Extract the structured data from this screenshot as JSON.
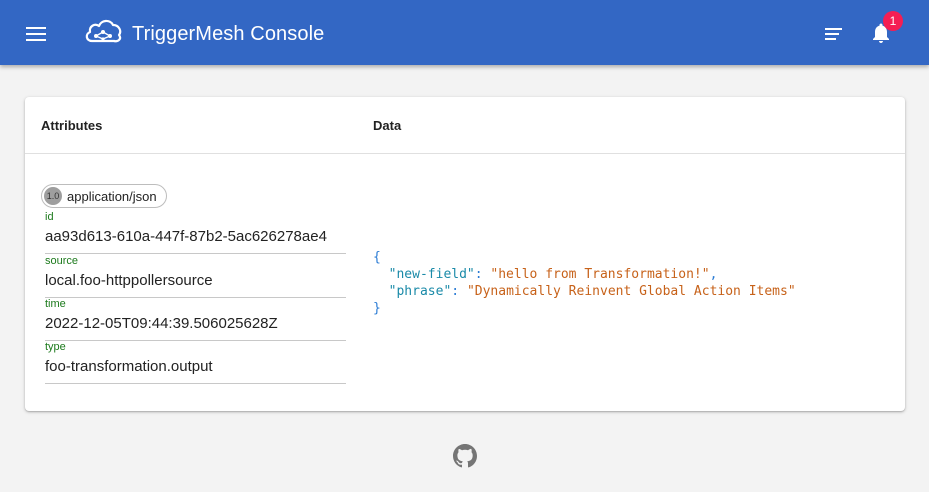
{
  "app": {
    "title": "TriggerMesh Console",
    "notification_count": "1",
    "accent_color": "#3367c4",
    "badge_color": "#f51e53"
  },
  "icons": {
    "menu": "menu-icon",
    "logo": "cloud-network-icon",
    "sort": "sort-icon",
    "bell": "bell-icon",
    "footer": "github-icon"
  },
  "table": {
    "col_attributes": "Attributes",
    "col_data": "Data"
  },
  "event": {
    "specversion": "1.0",
    "datacontenttype": "application/json",
    "attributes": [
      {
        "label": "id",
        "value": "aa93d613-610a-447f-87b2-5ac626278ae4"
      },
      {
        "label": "source",
        "value": "local.foo-httppollersource"
      },
      {
        "label": "time",
        "value": "2022-12-05T09:44:39.506025628Z"
      },
      {
        "label": "type",
        "value": "foo-transformation.output"
      }
    ],
    "data": {
      "open_brace": "{",
      "close_brace": "}",
      "entries": [
        {
          "key": "\"new-field\"",
          "value": "\"hello from Transformation!\"",
          "sep": ","
        },
        {
          "key": "\"phrase\"",
          "value": "\"Dynamically Reinvent Global Action Items\"",
          "sep": ""
        }
      ]
    }
  }
}
